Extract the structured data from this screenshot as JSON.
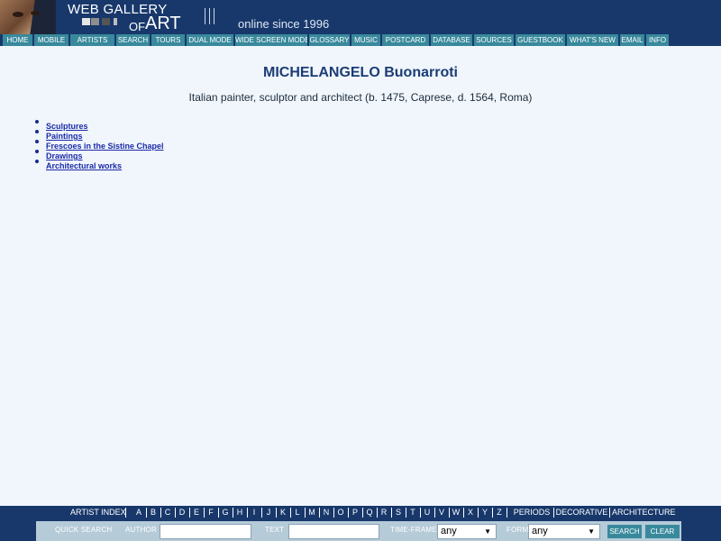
{
  "header": {
    "logo_line1": "WEB GALLERY",
    "logo_line2a": "OF",
    "logo_line2b": "ART",
    "tagline": "online since 1996"
  },
  "nav": [
    "HOME",
    "MOBILE",
    "ARTISTS",
    "SEARCH",
    "TOURS",
    "DUAL MODE",
    "WIDE SCREEN MODES",
    "GLOSSARY",
    "MUSIC",
    "POSTCARD",
    "DATABASE",
    "SOURCES",
    "GUESTBOOK",
    "WHAT'S NEW",
    "EMAIL",
    "INFO"
  ],
  "main": {
    "title": "MICHELANGELO Buonarroti",
    "subtitle": "Italian painter, sculptor and architect (b. 1475, Caprese, d. 1564, Roma)",
    "works": [
      "Sculptures",
      "Paintings",
      "Frescoes in the Sistine Chapel",
      "Drawings",
      "Architectural works"
    ]
  },
  "alpha": {
    "index_label": "ARTIST INDEX",
    "letters": [
      "A",
      "B",
      "C",
      "D",
      "E",
      "F",
      "G",
      "H",
      "I",
      "J",
      "K",
      "L",
      "M",
      "N",
      "O",
      "P",
      "Q",
      "R",
      "S",
      "T",
      "U",
      "V",
      "W",
      "X",
      "Y",
      "Z"
    ],
    "extra": [
      "PERIODS",
      "DECORATIVE",
      "ARCHITECTURE"
    ]
  },
  "quick_search": {
    "label": "QUICK SEARCH",
    "author_label": "AUTHOR",
    "author_value": "",
    "text_label": "TEXT",
    "text_value": "",
    "timeframe_label": "TIME-FRAME",
    "timeframe_value": "any",
    "form_label": "FORM",
    "form_value": "any",
    "search_button": "SEARCH",
    "clear_button": "CLEAR"
  }
}
